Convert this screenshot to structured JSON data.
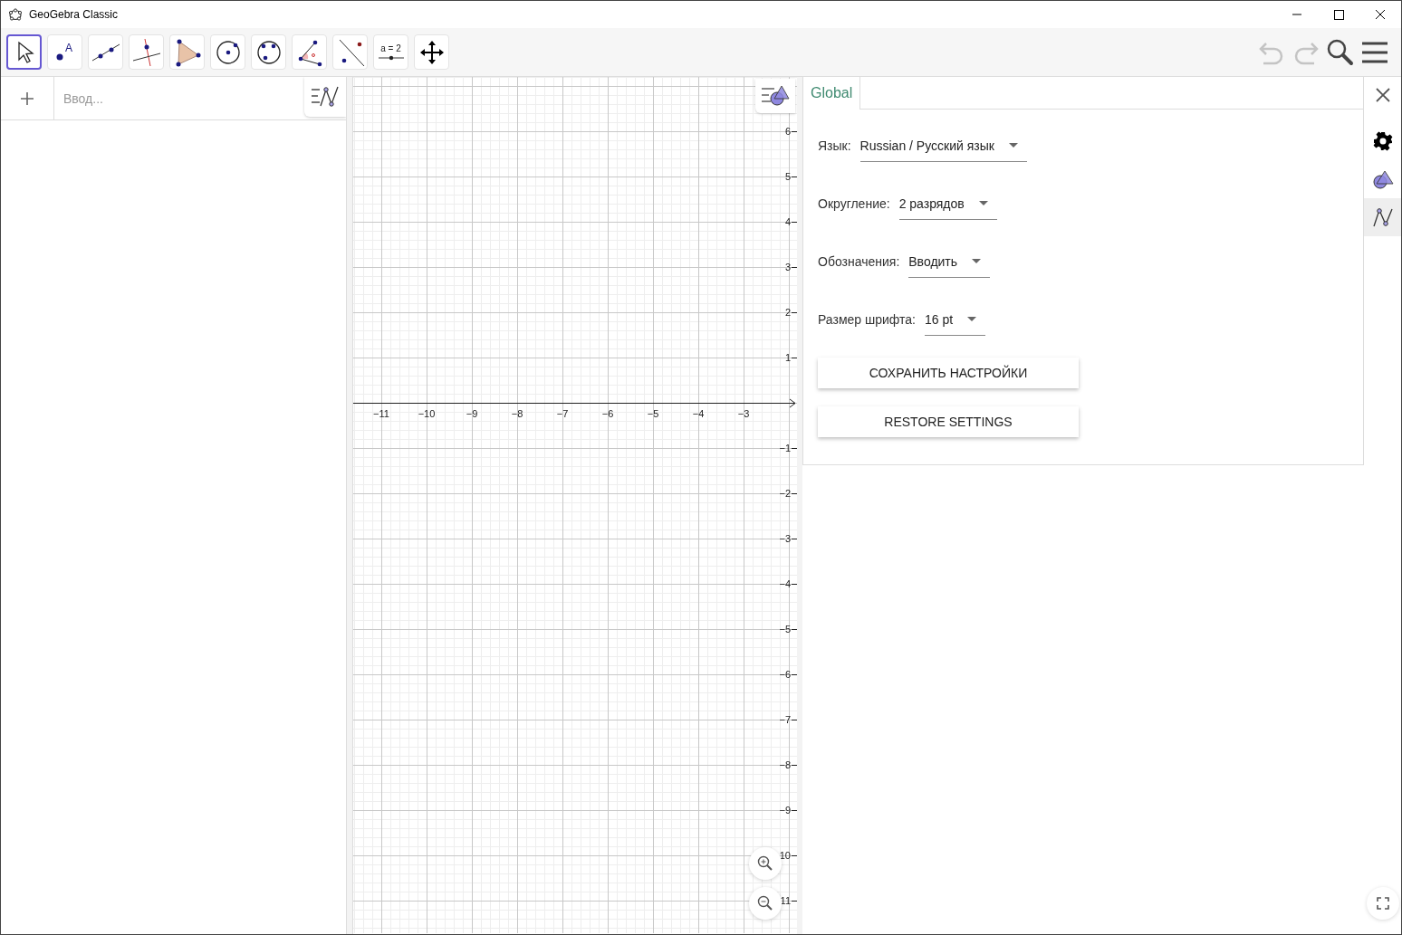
{
  "window": {
    "title": "GeoGebra Classic"
  },
  "toolbar": {
    "tools": [
      {
        "kind": "move",
        "selected": true
      },
      {
        "kind": "point",
        "label": "A",
        "selected": false
      },
      {
        "kind": "line",
        "selected": false
      },
      {
        "kind": "perpendicular",
        "selected": false
      },
      {
        "kind": "polygon",
        "selected": false
      },
      {
        "kind": "circle",
        "selected": false
      },
      {
        "kind": "circle3",
        "selected": false
      },
      {
        "kind": "angle",
        "selected": false
      },
      {
        "kind": "reflect",
        "selected": false
      },
      {
        "kind": "slider",
        "label": "a = 2",
        "selected": false
      },
      {
        "kind": "pan",
        "selected": false
      }
    ],
    "actions": [
      {
        "kind": "undo",
        "disabled": true
      },
      {
        "kind": "redo",
        "disabled": true
      },
      {
        "kind": "search",
        "disabled": false
      },
      {
        "kind": "menu",
        "disabled": false
      }
    ]
  },
  "algebra": {
    "input": {
      "placeholder": "Ввод..."
    }
  },
  "graphics": {
    "x_labels": [
      "−11",
      "−10",
      "−9",
      "−8",
      "−7",
      "−6",
      "−5",
      "−4",
      "−3"
    ],
    "y_labels": [
      "6",
      "5",
      "4",
      "3",
      "2",
      "1",
      "−1",
      "−2",
      "−3",
      "−4",
      "−5",
      "−6",
      "−7",
      "−8",
      "−9",
      "10",
      "11"
    ]
  },
  "settings": {
    "tabs": [
      {
        "label": "Global",
        "selected": true
      }
    ],
    "rows": [
      {
        "label": "Язык:",
        "value": "Russian / Русский язык"
      },
      {
        "label": "Округление:",
        "value": "2 разрядов"
      },
      {
        "label": "Обозначения:",
        "value": "Вводить"
      },
      {
        "label": "Размер шрифта:",
        "value": "16 pt"
      }
    ],
    "buttons": [
      "СОХРАНИТЬ НАСТРОЙКИ",
      "RESTORE SETTINGS"
    ]
  },
  "sidebar": {
    "items": [
      {
        "kind": "settings",
        "selected": false
      },
      {
        "kind": "graphics",
        "selected": false
      },
      {
        "kind": "algebra",
        "selected": true
      }
    ]
  }
}
